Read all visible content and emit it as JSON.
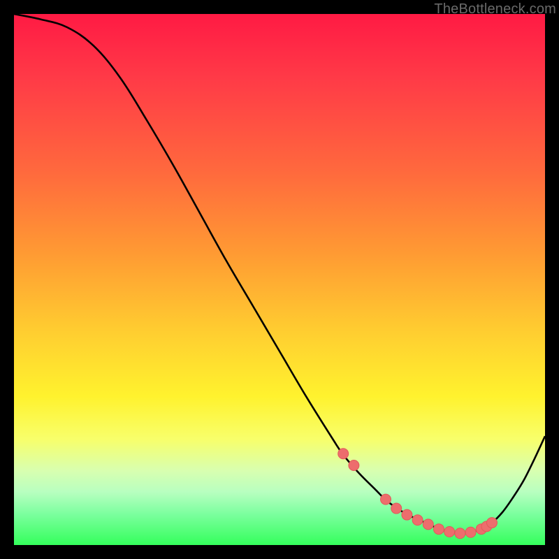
{
  "watermark": "TheBottleneck.com",
  "colors": {
    "curve": "#000000",
    "marker_fill": "#ed6d6d",
    "marker_stroke": "#e15a5a",
    "background": "#000000"
  },
  "chart_data": {
    "type": "line",
    "title": "",
    "xlabel": "",
    "ylabel": "",
    "xlim": [
      0,
      100
    ],
    "ylim": [
      0,
      100
    ],
    "grid": false,
    "legend": null,
    "series": [
      {
        "name": "curve",
        "x": [
          0,
          5,
          10,
          15,
          20,
          25,
          30,
          35,
          40,
          45,
          50,
          55,
          60,
          62,
          65,
          68,
          70,
          72,
          74,
          76,
          78,
          80,
          82,
          84,
          86,
          88,
          90,
          92,
          94,
          96,
          98,
          100
        ],
        "y": [
          100,
          99,
          97.5,
          94,
          88,
          80,
          71.5,
          62.5,
          53.5,
          45,
          36.5,
          28,
          20,
          17,
          13.5,
          10.5,
          8.5,
          7,
          5.8,
          4.8,
          4,
          3,
          2.5,
          2.2,
          2.4,
          3,
          4.2,
          6.2,
          9,
          12.2,
          16.2,
          20.5
        ]
      }
    ],
    "markers": {
      "name": "dots",
      "x": [
        62,
        64,
        70,
        72,
        74,
        76,
        78,
        80,
        82,
        84,
        86,
        88,
        89,
        90
      ],
      "y": [
        17.2,
        15.0,
        8.6,
        6.9,
        5.7,
        4.7,
        3.9,
        3.0,
        2.5,
        2.2,
        2.4,
        3.0,
        3.5,
        4.2
      ]
    }
  }
}
